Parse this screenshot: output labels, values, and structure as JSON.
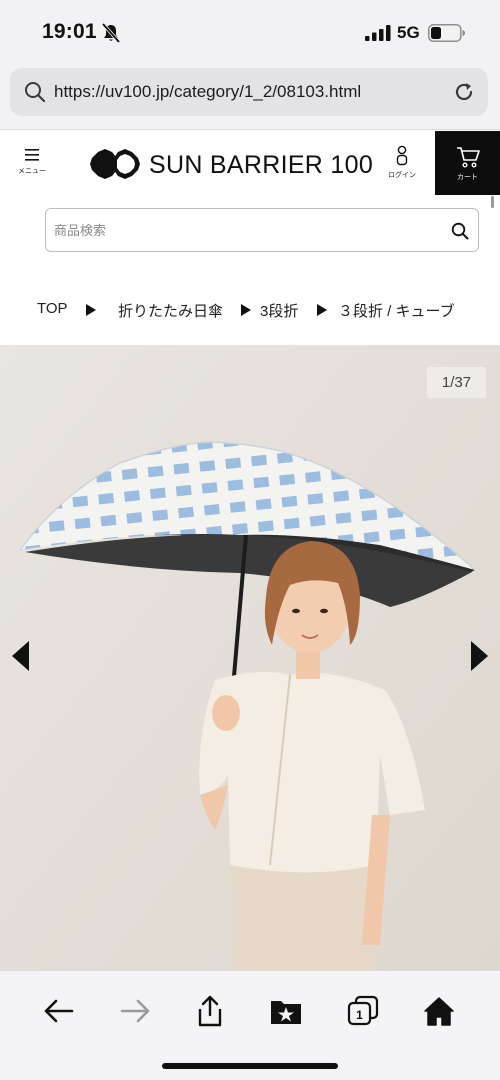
{
  "status_bar": {
    "time": "19:01",
    "network": "5G",
    "icons": [
      "bell-slash-icon",
      "signal-icon",
      "battery-icon"
    ]
  },
  "browser": {
    "url": "https://uv100.jp/category/1_2/08103.html",
    "icons": [
      "search-icon",
      "reload-icon"
    ]
  },
  "header": {
    "menu_label": "メニュー",
    "logo_text": "SUN BARRIER 100",
    "login_label": "ログイン",
    "cart_label": "カート",
    "icons": [
      "hamburger-icon",
      "logo-mark-icon",
      "person-icon",
      "cart-icon"
    ]
  },
  "search": {
    "placeholder": "商品検索",
    "value": ""
  },
  "breadcrumb": {
    "items": [
      "TOP",
      "折りたたみ日傘",
      "3段折",
      "３段折 / キューブ"
    ]
  },
  "gallery": {
    "counter": "1/37",
    "current": 1,
    "total": 37,
    "icons": [
      "arrow-left-icon",
      "arrow-right-icon"
    ]
  },
  "toolbar": {
    "icons": [
      "back-arrow-icon",
      "forward-arrow-icon",
      "share-icon",
      "bookmarks-icon",
      "tabs-icon",
      "home-icon"
    ],
    "tabs_count": "1"
  },
  "colors": {
    "cart_bg": "#0d0d0d",
    "photo_bg": "#e6e1db",
    "umbrella_pattern": "#8fb0d6"
  }
}
